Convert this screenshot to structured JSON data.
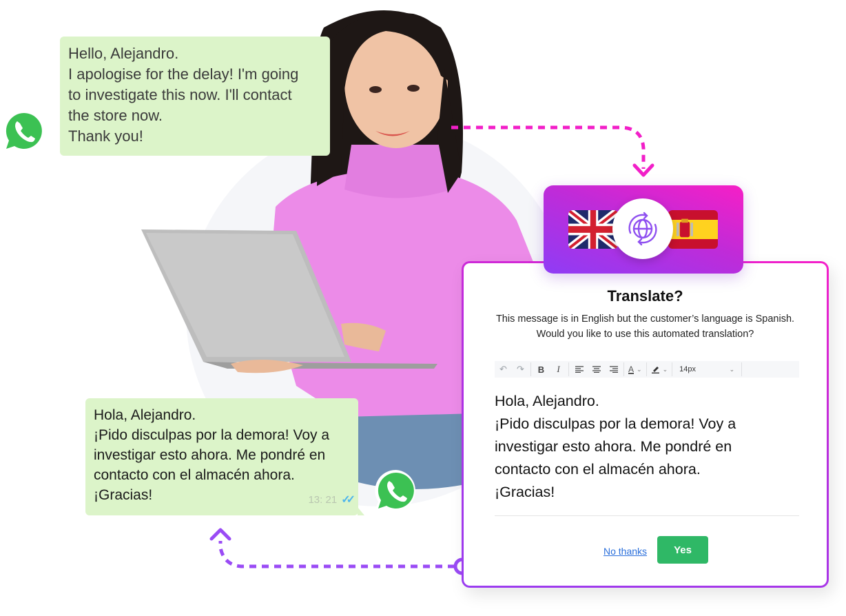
{
  "colors": {
    "bubble_bg": "#dcf4c9",
    "whatsapp_green": "#2fbe4f",
    "connector_pink": "#f21fc8",
    "connector_purple": "#9a4bf5",
    "yes_green": "#2fb866",
    "link_blue": "#2a6fdb"
  },
  "whatsapp_original": {
    "lines": [
      "Hello, Alejandro.",
      "I apologise for the delay! I'm going",
      "to investigate this now. I'll contact",
      "the store now.",
      "Thank you!"
    ],
    "icon": "whatsapp-icon"
  },
  "whatsapp_translated": {
    "lines": [
      "Hola, Alejandro.",
      "¡Pido disculpas por la demora! Voy a",
      "investigar esto ahora. Me pondré en",
      "contacto con el almacén ahora.",
      "¡Gracias!"
    ],
    "time": "13: 21",
    "status_icon": "double-check-icon",
    "icon": "whatsapp-icon"
  },
  "language_card": {
    "source_flag": "uk-flag-icon",
    "target_flag": "spain-flag-icon",
    "center_icon": "globe-translate-icon"
  },
  "dialog": {
    "title": "Translate?",
    "description_lines": [
      "This message is in English but the customer’s language is Spanish.",
      "Would you like to use this automated translation?"
    ],
    "toolbar": {
      "undo": "↶",
      "redo": "↷",
      "bold": "B",
      "italic": "I",
      "font_color_label": "A",
      "font_size": "14px"
    },
    "editor_lines": [
      "Hola, Alejandro.",
      "¡Pido disculpas por la demora! Voy a",
      "investigar esto ahora. Me pondré en",
      "contacto con el almacén ahora.",
      "¡Gracias!"
    ],
    "no_thanks_label": "No thanks",
    "yes_label": "Yes"
  }
}
